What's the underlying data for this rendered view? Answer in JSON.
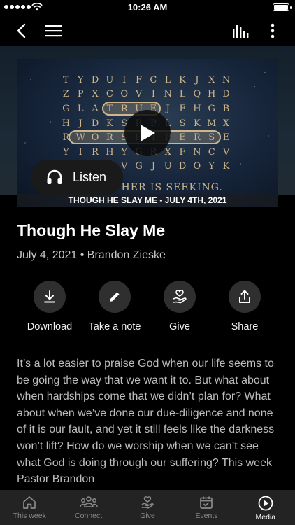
{
  "status_bar": {
    "time": "10:26 AM"
  },
  "hero": {
    "letter_grid": [
      "TYDUIFCLKJXN",
      "ZPXCOVINLQHD",
      "GLATRUEJFHGB",
      "HJDKSRPLSKMX",
      "RWORSHIPERSE",
      "YIRHYGRXFNCV",
      "XMVMVGJUDOYK"
    ],
    "tagline": "THE FATHER IS SEEKING.",
    "caption": "THOUGH HE SLAY ME - JULY 4TH, 2021",
    "listen_label": "Listen"
  },
  "sermon": {
    "title": "Though He Slay Me",
    "date": "July 4, 2021",
    "separator": "•",
    "speaker": "Brandon Zieske",
    "description": "It’s a lot easier to praise God when our life seems to be going the way that we want it to. But what about when hardships come that we didn’t plan for? What about when we’ve done our due-diligence and none of it is our fault, and yet it still feels like the darkness won’t lift? How do we worship when we can’t see what God is doing through our suffering? This week Pastor Brandon"
  },
  "actions": [
    {
      "label": "Download",
      "icon": "download-icon"
    },
    {
      "label": "Take a note",
      "icon": "pencil-icon"
    },
    {
      "label": "Give",
      "icon": "hand-heart-icon"
    },
    {
      "label": "Share",
      "icon": "share-icon"
    }
  ],
  "tabs": [
    {
      "label": "This week",
      "icon": "home-icon",
      "active": false
    },
    {
      "label": "Connect",
      "icon": "people-icon",
      "active": false
    },
    {
      "label": "Give",
      "icon": "hand-heart-icon",
      "active": false
    },
    {
      "label": "Events",
      "icon": "calendar-icon",
      "active": false
    },
    {
      "label": "Media",
      "icon": "play-circle-icon",
      "active": true
    }
  ]
}
